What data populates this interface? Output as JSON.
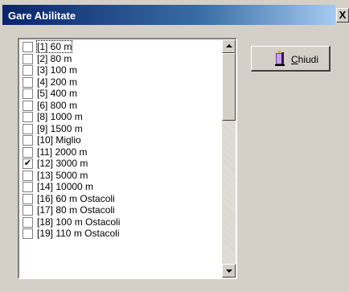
{
  "window": {
    "title": "Gare Abilitate",
    "close_glyph": "X"
  },
  "close_button": {
    "mnemonic": "C",
    "label_rest": "hiudi",
    "icon": "exit-door-icon"
  },
  "list": {
    "items": [
      {
        "label": "[1] 60 m",
        "checked": false,
        "focused": true
      },
      {
        "label": "[2] 80 m",
        "checked": false
      },
      {
        "label": "[3] 100 m",
        "checked": false
      },
      {
        "label": "[4] 200 m",
        "checked": false
      },
      {
        "label": "[5] 400 m",
        "checked": false
      },
      {
        "label": "[6] 800 m",
        "checked": false
      },
      {
        "label": "[8] 1000 m",
        "checked": false
      },
      {
        "label": "[9] 1500 m",
        "checked": false
      },
      {
        "label": "[10] Miglio",
        "checked": false
      },
      {
        "label": "[11] 2000 m",
        "checked": false
      },
      {
        "label": "[12] 3000 m",
        "checked": true
      },
      {
        "label": "[13] 5000 m",
        "checked": false
      },
      {
        "label": "[14] 10000 m",
        "checked": false
      },
      {
        "label": "[16] 60 m Ostacoli",
        "checked": false
      },
      {
        "label": "[17] 80 m Ostacoli",
        "checked": false
      },
      {
        "label": "[18] 100 m Ostacoli",
        "checked": false
      },
      {
        "label": "[19] 110 m Ostacoli",
        "checked": false
      }
    ],
    "check_glyph": "✔"
  },
  "colors": {
    "titlebar_start": "#0a246a",
    "titlebar_end": "#a6caf0",
    "face": "#d4d0c8"
  }
}
